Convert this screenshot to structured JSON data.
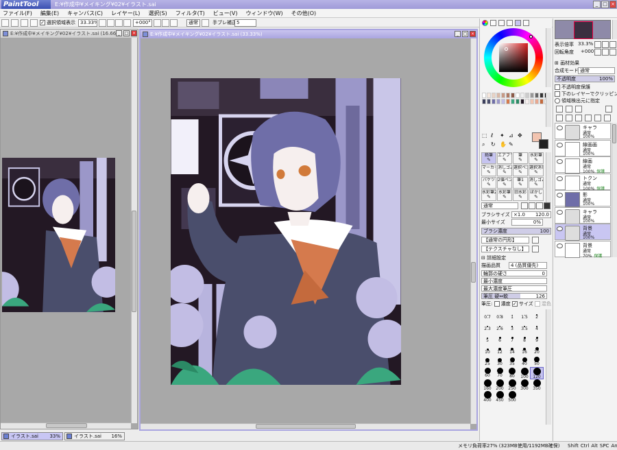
{
  "app": {
    "logo": "PaintTool SAI",
    "title": "E:¥作成中¥メイキング¥02¥イラスト.sai",
    "colors": {
      "accent": "#a9a4e0",
      "selection": "#c8c6f4",
      "close": "#d44444"
    }
  },
  "menu": [
    "ファイル(F)",
    "編集(E)",
    "キャンバス(C)",
    "レイヤー(L)",
    "選択(S)",
    "フィルタ(T)",
    "ビュー(V)",
    "ウィンドウ(W)",
    "その他(O)"
  ],
  "toolbar": {
    "selection_display": "選択領域表示",
    "selection_display_checked": true,
    "zoom": "33.33%",
    "rotation": "+000°",
    "blend": "通常",
    "stabilizer_label": "手ブレ補正",
    "stabilizer_value": "5"
  },
  "windows": [
    {
      "title": "E:¥作成中¥メイキング¥02¥イラスト.sai (16.66%)",
      "active": false
    },
    {
      "title": "E:¥作成中¥メイキング¥02¥イラスト.sai (33.33%)",
      "active": true
    }
  ],
  "tabs": [
    {
      "name": "イラスト.sai",
      "zoom": "33%",
      "active": true
    },
    {
      "name": "イラスト.sai",
      "zoom": "16%",
      "active": false
    }
  ],
  "status": {
    "memory": "メモリ負荷率27% (323MB使用/1192MB確保)",
    "keys": [
      "Shift",
      "Ctrl",
      "Alt",
      "SPC",
      "Any"
    ]
  },
  "color_panel": {
    "primary_color": "#f2c4b0",
    "secondary_color": "#ffffff",
    "hue_selected": "#d81e1e"
  },
  "tools": [
    "鉛筆",
    "エアブラシ",
    "筆",
    "水彩筆",
    "マーカー",
    "消しゴム",
    "選択ペン",
    "選択消し",
    "バケツ",
    "2値ペン",
    "筆1",
    "消しゴム",
    "水彩筆2",
    "水彩筆",
    "旧水彩",
    "ぼかし"
  ],
  "brush_settings": {
    "mode": "通常",
    "size_label": "ブラシサイズ",
    "size_multiplier": "×1.0",
    "size_value": "120.0",
    "min_size_label": "最小サイズ",
    "min_size_value": "0%",
    "density_label": "ブラシ濃度",
    "density_value": "100",
    "density_fraction": 1.0,
    "edge": "【通常の円形】",
    "texture": "【テクスチャなし】",
    "detail_label": "詳細設定",
    "quality_label": "描画品質",
    "quality_value": "4 (品質優先)",
    "edge_hardness_label": "輪郭の硬さ",
    "edge_hardness_value": "0",
    "min_density_label": "最小濃度",
    "max_density_label": "最大濃度筆圧",
    "pressure_label": "筆圧 硬⇔軟",
    "pressure_value": "126",
    "pressure_check_label": "筆圧:",
    "pressure_density": "濃度",
    "pressure_size": "サイズ",
    "pressure_blend": "混色",
    "pressure_size_checked": true
  },
  "brush_sizes": [
    "0.7",
    "0.8",
    "1",
    "1.5",
    "2",
    "2.3",
    "2.6",
    "3",
    "3.5",
    "4",
    "5",
    "6",
    "7",
    "8",
    "9",
    "10",
    "12",
    "14",
    "16",
    "20",
    "25",
    "30",
    "35",
    "40",
    "50",
    "60",
    "70",
    "80",
    "100",
    "120",
    "160",
    "200",
    "250",
    "300",
    "350",
    "400",
    "450",
    "500"
  ],
  "brush_selected": "120",
  "navigator": {
    "zoom_label": "表示倍率",
    "zoom_value": "33.3%",
    "angle_label": "回転角度",
    "angle_value": "+000°"
  },
  "layer_panel": {
    "paper_effect": "画材効果",
    "blend_label": "合成モード",
    "blend_value": "通常",
    "opacity_label": "不透明度",
    "opacity_value": "100%",
    "opt_protect": "不透明度保護",
    "opt_clip": "下のレイヤーでクリッピング",
    "opt_sample": "領域検出元に指定"
  },
  "layers": [
    {
      "name": "キャラ",
      "mode": "通常",
      "opacity": "100%",
      "tag": "",
      "folder": true,
      "selected": false
    },
    {
      "name": "線画画",
      "mode": "通常",
      "opacity": "100%",
      "tag": "",
      "folder": false,
      "selected": false
    },
    {
      "name": "線画",
      "mode": "通常",
      "opacity": "100%",
      "tag": "保護",
      "folder": false,
      "selected": false
    },
    {
      "name": "トクン",
      "mode": "通常",
      "opacity": "100%",
      "tag": "保護",
      "folder": false,
      "selected": false
    },
    {
      "name": "影",
      "mode": "通常",
      "opacity": "100%",
      "tag": "",
      "folder": false,
      "selected": false
    },
    {
      "name": "キャラ",
      "mode": "通常",
      "opacity": "100%",
      "tag": "",
      "folder": true,
      "selected": false
    },
    {
      "name": "背景",
      "mode": "通常",
      "opacity": "100%",
      "tag": "",
      "folder": true,
      "selected": true
    },
    {
      "name": "背景",
      "mode": "通常",
      "opacity": "70%",
      "tag": "保護",
      "folder": false,
      "selected": false
    }
  ]
}
